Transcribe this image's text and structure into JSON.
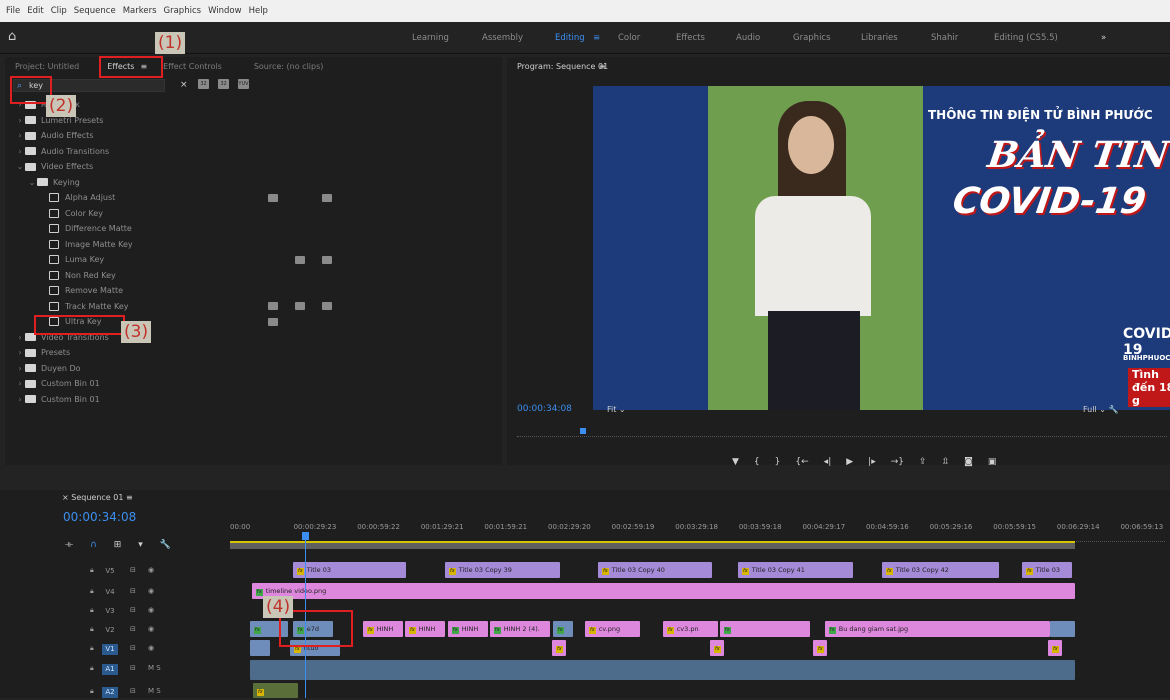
{
  "menubar": [
    "File",
    "Edit",
    "Clip",
    "Sequence",
    "Markers",
    "Graphics",
    "Window",
    "Help"
  ],
  "workspaces": [
    {
      "label": "Learning",
      "active": false
    },
    {
      "label": "Assembly",
      "active": false
    },
    {
      "label": "Editing",
      "active": true
    },
    {
      "label": "Color",
      "active": false
    },
    {
      "label": "Effects",
      "active": false
    },
    {
      "label": "Audio",
      "active": false
    },
    {
      "label": "Graphics",
      "active": false
    },
    {
      "label": "Libraries",
      "active": false
    },
    {
      "label": "Shahir",
      "active": false
    },
    {
      "label": "Editing (CS5.5)",
      "active": false
    }
  ],
  "workspace_more": "»",
  "editing_menu": "≡",
  "left_panel": {
    "tabs": [
      "Project: Untitled",
      "Effects",
      "≡",
      "Effect Controls",
      "Source: (no clips)"
    ],
    "search_value": "key",
    "search_clear": "×",
    "bin_icons": [
      "32",
      "32",
      "YUV"
    ]
  },
  "effects_tree": [
    {
      "label": "настроек",
      "level": 0,
      "type": "folder-preset",
      "open": false
    },
    {
      "label": "Lumetri Presets",
      "level": 0,
      "type": "folder-preset",
      "open": false
    },
    {
      "label": "Audio Effects",
      "level": 0,
      "type": "folder",
      "open": false
    },
    {
      "label": "Audio Transitions",
      "level": 0,
      "type": "folder",
      "open": false
    },
    {
      "label": "Video Effects",
      "level": 0,
      "type": "folder",
      "open": true
    },
    {
      "label": "Keying",
      "level": 1,
      "type": "folder",
      "open": true
    },
    {
      "label": "Alpha Adjust",
      "level": 2,
      "type": "effect",
      "acc": [
        1,
        0,
        1
      ]
    },
    {
      "label": "Color Key",
      "level": 2,
      "type": "effect",
      "acc": [
        0,
        0,
        0
      ]
    },
    {
      "label": "Difference Matte",
      "level": 2,
      "type": "effect",
      "acc": [
        0,
        0,
        0
      ]
    },
    {
      "label": "Image Matte Key",
      "level": 2,
      "type": "effect",
      "acc": [
        0,
        0,
        0
      ]
    },
    {
      "label": "Luma Key",
      "level": 2,
      "type": "effect",
      "acc": [
        0,
        1,
        1
      ]
    },
    {
      "label": "Non Red Key",
      "level": 2,
      "type": "effect",
      "acc": [
        0,
        0,
        0
      ]
    },
    {
      "label": "Remove Matte",
      "level": 2,
      "type": "effect",
      "acc": [
        0,
        0,
        0
      ]
    },
    {
      "label": "Track Matte Key",
      "level": 2,
      "type": "effect",
      "acc": [
        1,
        1,
        1
      ]
    },
    {
      "label": "Ultra Key",
      "level": 2,
      "type": "effect",
      "acc": [
        1,
        0,
        0
      ]
    },
    {
      "label": "Video Transitions",
      "level": 0,
      "type": "folder",
      "open": false
    },
    {
      "label": "Presets",
      "level": 0,
      "type": "folder-preset",
      "open": false
    },
    {
      "label": "Duyen Do",
      "level": 0,
      "type": "folder",
      "open": false
    },
    {
      "label": "Custom Bin 01",
      "level": 0,
      "type": "folder",
      "open": false
    },
    {
      "label": "Custom Bin 01",
      "level": 0,
      "type": "folder",
      "open": false
    }
  ],
  "annotations": [
    "(1)",
    "(2)",
    "(3)",
    "(4)"
  ],
  "program": {
    "title": "Program: Sequence 01",
    "menu": "≡",
    "timecode": "00:00:34:08",
    "fit": "Fit",
    "full": "Full",
    "news_header": "THÔNG TIN ĐIỆN TỬ BÌNH PHƯỚC",
    "news_title1": "BẢN TIN",
    "news_title2": "COVID-19",
    "news_small": "BINHPHUOC.GOV.VN",
    "news_bottom": "Tình đến 18 g",
    "news_badge": "COVID-19"
  },
  "timeline": {
    "tab": "Sequence 01",
    "menu": "≡",
    "timecode": "00:00:34:08",
    "ruler_labels": [
      "00:00",
      "00:00:29:23",
      "00:00:59:22",
      "00:01:29:21",
      "00:01:59:21",
      "00:02:29:20",
      "00:02:59:19",
      "00:03:29:18",
      "00:03:59:18",
      "00:04:29:17",
      "00:04:59:16",
      "00:05:29:16",
      "00:05:59:15",
      "00:06:29:14",
      "00:06:59:13"
    ],
    "tracks": [
      {
        "name": "V5",
        "on": false
      },
      {
        "name": "V4",
        "on": false
      },
      {
        "name": "V3",
        "on": false
      },
      {
        "name": "V2",
        "on": false
      },
      {
        "name": "V1",
        "on": true
      },
      {
        "name": "A1",
        "on": true
      },
      {
        "name": "A2",
        "on": true
      }
    ],
    "v5_clips": [
      "Title 03",
      "Title 03 Copy 39",
      "Title 03 Copy 40",
      "Title 03 Copy 41",
      "Title 03 Copy 42",
      "Title 03"
    ],
    "v4_clip": "timeline video.png",
    "v2_clips": [
      "e7d",
      "HINH",
      "HINH",
      "HINH",
      "HINH 2 (4).",
      "cv.png",
      "cv3.pn",
      "Bu dang giam sat.jpg"
    ],
    "v1_clip": "ntuo"
  }
}
